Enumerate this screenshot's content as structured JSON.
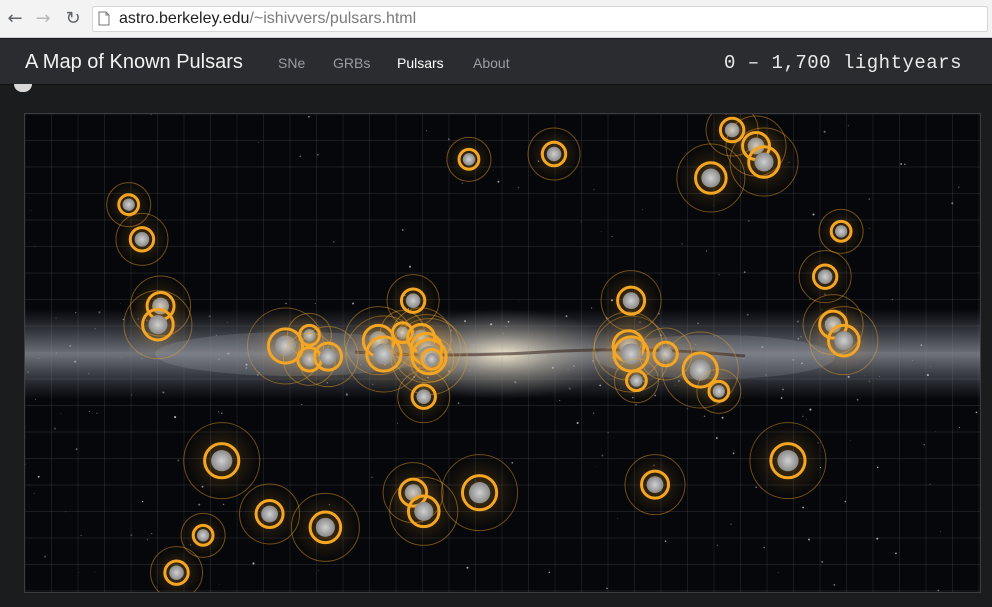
{
  "browser": {
    "url_host": "astro.berkeley.edu",
    "url_path": "/~ishivvers/pulsars.html"
  },
  "header": {
    "title": "A Map of Known Pulsars",
    "nav": [
      {
        "label": "SNe",
        "active": false
      },
      {
        "label": "GRBs",
        "active": false
      },
      {
        "label": "Pulsars",
        "active": true
      },
      {
        "label": "About",
        "active": false
      }
    ],
    "distance_range": "0 – 1,700 lightyears"
  },
  "colors": {
    "accent": "#f5a623",
    "nav_bg": "#2a2c30"
  },
  "map": {
    "lon_range": [
      180,
      -180
    ],
    "lat_range": [
      -90,
      90
    ],
    "pulsars": [
      {
        "lon": 141,
        "lat": 56
      },
      {
        "lon": 136,
        "lat": 43
      },
      {
        "lon": 129,
        "lat": 18
      },
      {
        "lon": 130,
        "lat": 11
      },
      {
        "lon": 106,
        "lat": -40
      },
      {
        "lon": 113,
        "lat": -68
      },
      {
        "lon": 123,
        "lat": -82
      },
      {
        "lon": 88,
        "lat": -60
      },
      {
        "lon": 67,
        "lat": -65
      },
      {
        "lon": 82,
        "lat": 3
      },
      {
        "lon": 73,
        "lat": 7
      },
      {
        "lon": 73,
        "lat": -2
      },
      {
        "lon": 66,
        "lat": -1
      },
      {
        "lon": 47,
        "lat": 5
      },
      {
        "lon": 45,
        "lat": 0
      },
      {
        "lon": 38,
        "lat": 8
      },
      {
        "lon": 34,
        "lat": 20
      },
      {
        "lon": 31,
        "lat": 6
      },
      {
        "lon": 29,
        "lat": 2
      },
      {
        "lon": 28,
        "lat": -1
      },
      {
        "lon": 27,
        "lat": -2
      },
      {
        "lon": 30,
        "lat": -16
      },
      {
        "lon": 34,
        "lat": -52
      },
      {
        "lon": 30,
        "lat": -59
      },
      {
        "lon": 9,
        "lat": -52
      },
      {
        "lon": 13,
        "lat": 73
      },
      {
        "lon": -19,
        "lat": 75
      },
      {
        "lon": -48,
        "lat": 20
      },
      {
        "lon": -47,
        "lat": 3
      },
      {
        "lon": -48,
        "lat": 0
      },
      {
        "lon": -50,
        "lat": -10
      },
      {
        "lon": -61,
        "lat": 0
      },
      {
        "lon": -57,
        "lat": -49
      },
      {
        "lon": -78,
        "lat": 66
      },
      {
        "lon": -74,
        "lat": -6
      },
      {
        "lon": -81,
        "lat": -14
      },
      {
        "lon": -86,
        "lat": 84
      },
      {
        "lon": -95,
        "lat": 78
      },
      {
        "lon": -98,
        "lat": 72
      },
      {
        "lon": -107,
        "lat": -40
      },
      {
        "lon": -127,
        "lat": 46
      },
      {
        "lon": -121,
        "lat": 29
      },
      {
        "lon": -124,
        "lat": 11
      },
      {
        "lon": -128,
        "lat": 5
      }
    ]
  }
}
